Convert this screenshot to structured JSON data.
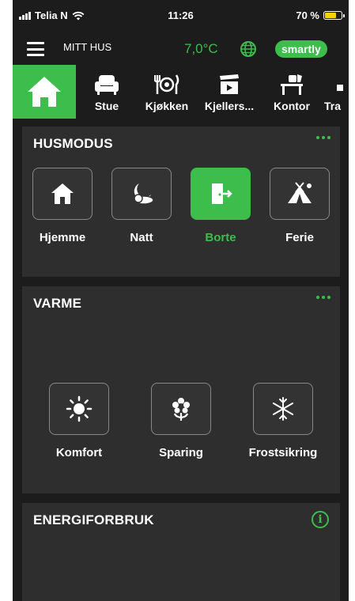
{
  "status_bar": {
    "carrier": "Telia N",
    "time": "11:26",
    "battery": "70 %",
    "battery_level": 0.7
  },
  "header": {
    "home_name": "MITT HUS",
    "temperature": "7,0°C",
    "brand": "smartly"
  },
  "rooms": [
    {
      "label": "Stue",
      "icon": "armchair-icon"
    },
    {
      "label": "Kjøkken",
      "icon": "dining-icon"
    },
    {
      "label": "Kjellers...",
      "icon": "tv-icon"
    },
    {
      "label": "Kontor",
      "icon": "desk-chair-icon"
    },
    {
      "label": "Tra",
      "icon": "room-icon"
    }
  ],
  "husmodus": {
    "title": "HUSMODUS",
    "modes": [
      {
        "label": "Hjemme",
        "icon": "house-icon",
        "active": false
      },
      {
        "label": "Natt",
        "icon": "moon-cloud-icon",
        "active": false
      },
      {
        "label": "Borte",
        "icon": "door-exit-icon",
        "active": true
      },
      {
        "label": "Ferie",
        "icon": "tent-icon",
        "active": false
      }
    ]
  },
  "varme": {
    "title": "VARME",
    "modes": [
      {
        "label": "Komfort",
        "icon": "sun-icon"
      },
      {
        "label": "Sparing",
        "icon": "flower-icon"
      },
      {
        "label": "Frostsikring",
        "icon": "snowflake-icon"
      }
    ]
  },
  "energi": {
    "title": "ENERGIFORBRUK"
  },
  "colors": {
    "accent": "#3dbd4c",
    "background": "#1c1c1c",
    "card": "#2e2e2e"
  }
}
